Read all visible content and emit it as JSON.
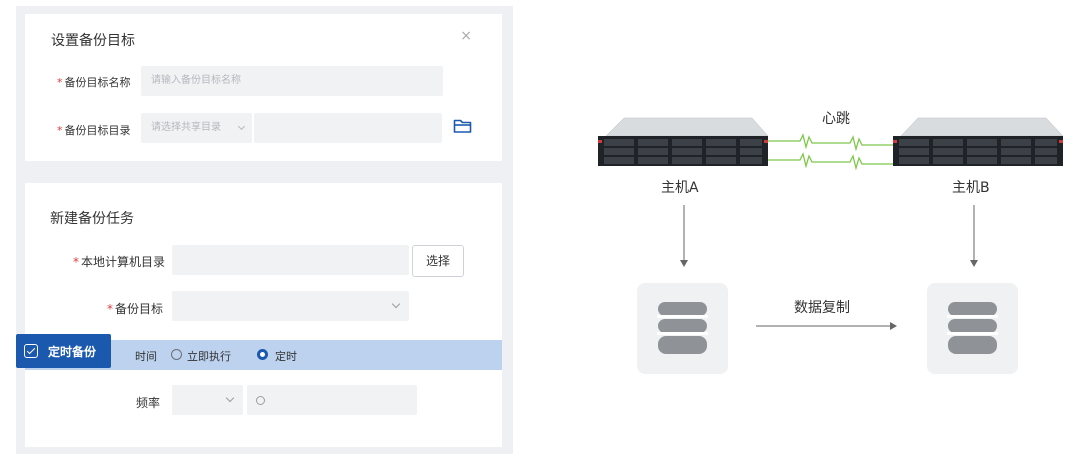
{
  "dialog": {
    "title": "设置备份目标",
    "close": "×",
    "target_name": {
      "label": "备份目标名称",
      "placeholder": "请输入备份目标名称"
    },
    "target_dir": {
      "label": "备份目标目录",
      "share_placeholder": "请选择共享目录"
    }
  },
  "task": {
    "title": "新建备份任务",
    "local_dir": {
      "label": "本地计算机目录",
      "button": "选择"
    },
    "backup_target": {
      "label": "备份目标"
    },
    "schedule_badge": "定时备份",
    "time": {
      "label": "时间",
      "options": [
        "立即执行",
        "定时"
      ],
      "selected": "定时"
    },
    "frequency": {
      "label": "频率"
    }
  },
  "diagram": {
    "heartbeat": "心跳",
    "host_a": "主机A",
    "host_b": "主机B",
    "replication": "数据复制"
  },
  "colors": {
    "accent": "#1b59ae",
    "highlight": "#bcd2ef",
    "required": "#e23b3b",
    "heartbeat_line": "#7ec84a"
  }
}
